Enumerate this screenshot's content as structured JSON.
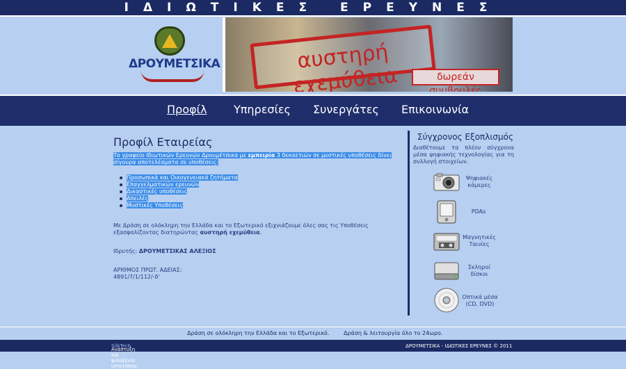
{
  "header": {
    "top_title": "ΙΔΙΩΤΙΚΕΣ ΕΡΕΥΝΕΣ",
    "logo_text": "ΔΡΟΥΜΕΤΣΙΚΑ",
    "banner_main": "αυστηρή εχεμύθεια",
    "banner_sub": "δωρεάν συμβουλές"
  },
  "nav": {
    "items": [
      {
        "label": "Προφίλ"
      },
      {
        "label": "Υπηρεσίες"
      },
      {
        "label": "Συνεργάτες"
      },
      {
        "label": "Επικοινωνία"
      }
    ],
    "active_index": 0
  },
  "main": {
    "title": "Προφίλ Εταιρείας",
    "intro_part1": "Το γραφείο Ιδιωτικών Ερευνών Δρουμέτσικα με ",
    "intro_bold": "εμπειρία",
    "intro_part2": " 3 δεκαετιών σε μυστικές υποθέσεις δίνει σίγουρα αποτελέσματα σε υποθέσεις:",
    "services": [
      "Προσωπικά και Οικογενειακά ζητήματα",
      "Επαγγελματικών ερευνών",
      "Δικαστικές υποθέσεις",
      "Απειλές",
      "Μυστικές Υποθέσεις"
    ],
    "coverage_text": "Με Δράση σε ολόκληρη την Ελλάδα και το Εξωτερικό εξιχνιάζουμε όλες σας τις Υποθέσεις εξασφαλίζοντας διατηρώντας ",
    "coverage_bold": "αυστηρή εχεμύθεια",
    "coverage_end": ".",
    "founder_label": "Ιδρυτής: ",
    "founder_name": "ΔΡΟΥΜΕΤΣΙΚΑΣ ΑΛΕΞΙΟΣ",
    "license_label": "ΑΡΙΘΜΟΣ ΠΡΩΤ. ΑΔΕΙΑΣ:",
    "license_number": "4891/7/1/112/-δ'"
  },
  "sidebar": {
    "title": "Σύγχρονος Εξοπλισμός",
    "description": "Διαθέτουμε τα πλέον σύγχρονα μέσα ψηφιακής τεχνολογίας για τη συλλογή στοιχείων.",
    "equipment": [
      {
        "line1": "Ψηφιακές",
        "line2": "κάμερες",
        "icon": "camera-icon"
      },
      {
        "line1": "PDAs",
        "line2": "",
        "icon": "pda-icon"
      },
      {
        "line1": "Μαγνητικές",
        "line2": "Ταινίες",
        "icon": "tape-icon"
      },
      {
        "line1": "Σκληροί",
        "line2": "δίσκοι",
        "icon": "hard-disk-icon"
      },
      {
        "line1": "Οπτικά μέσα",
        "line2": "(CD, DVD)",
        "icon": "optical-disc-icon"
      }
    ]
  },
  "footer": {
    "slogan1": "Δράση σε ολόκληρη την Ελλάδα και το Εξωτερικό.",
    "slogan2": "Δράση & λειτουργία όλο το 24ωρο.",
    "dev_label": "Ανάπτυξη και φιλοξενία ιστοτόπου: ",
    "dev_link": "SilkTech",
    "copyright": "ΔΡΟΥΜΕΤΣΙΚΑ - ΙΔΙΩΤΙΚΕΣ ΕΡΕΥΝΕΣ © 2011"
  },
  "colors": {
    "page_bg": "#b7cff0",
    "dark_navy": "#1b2a63",
    "highlight": "#3b8ce8",
    "stamp_red": "#c42424"
  }
}
